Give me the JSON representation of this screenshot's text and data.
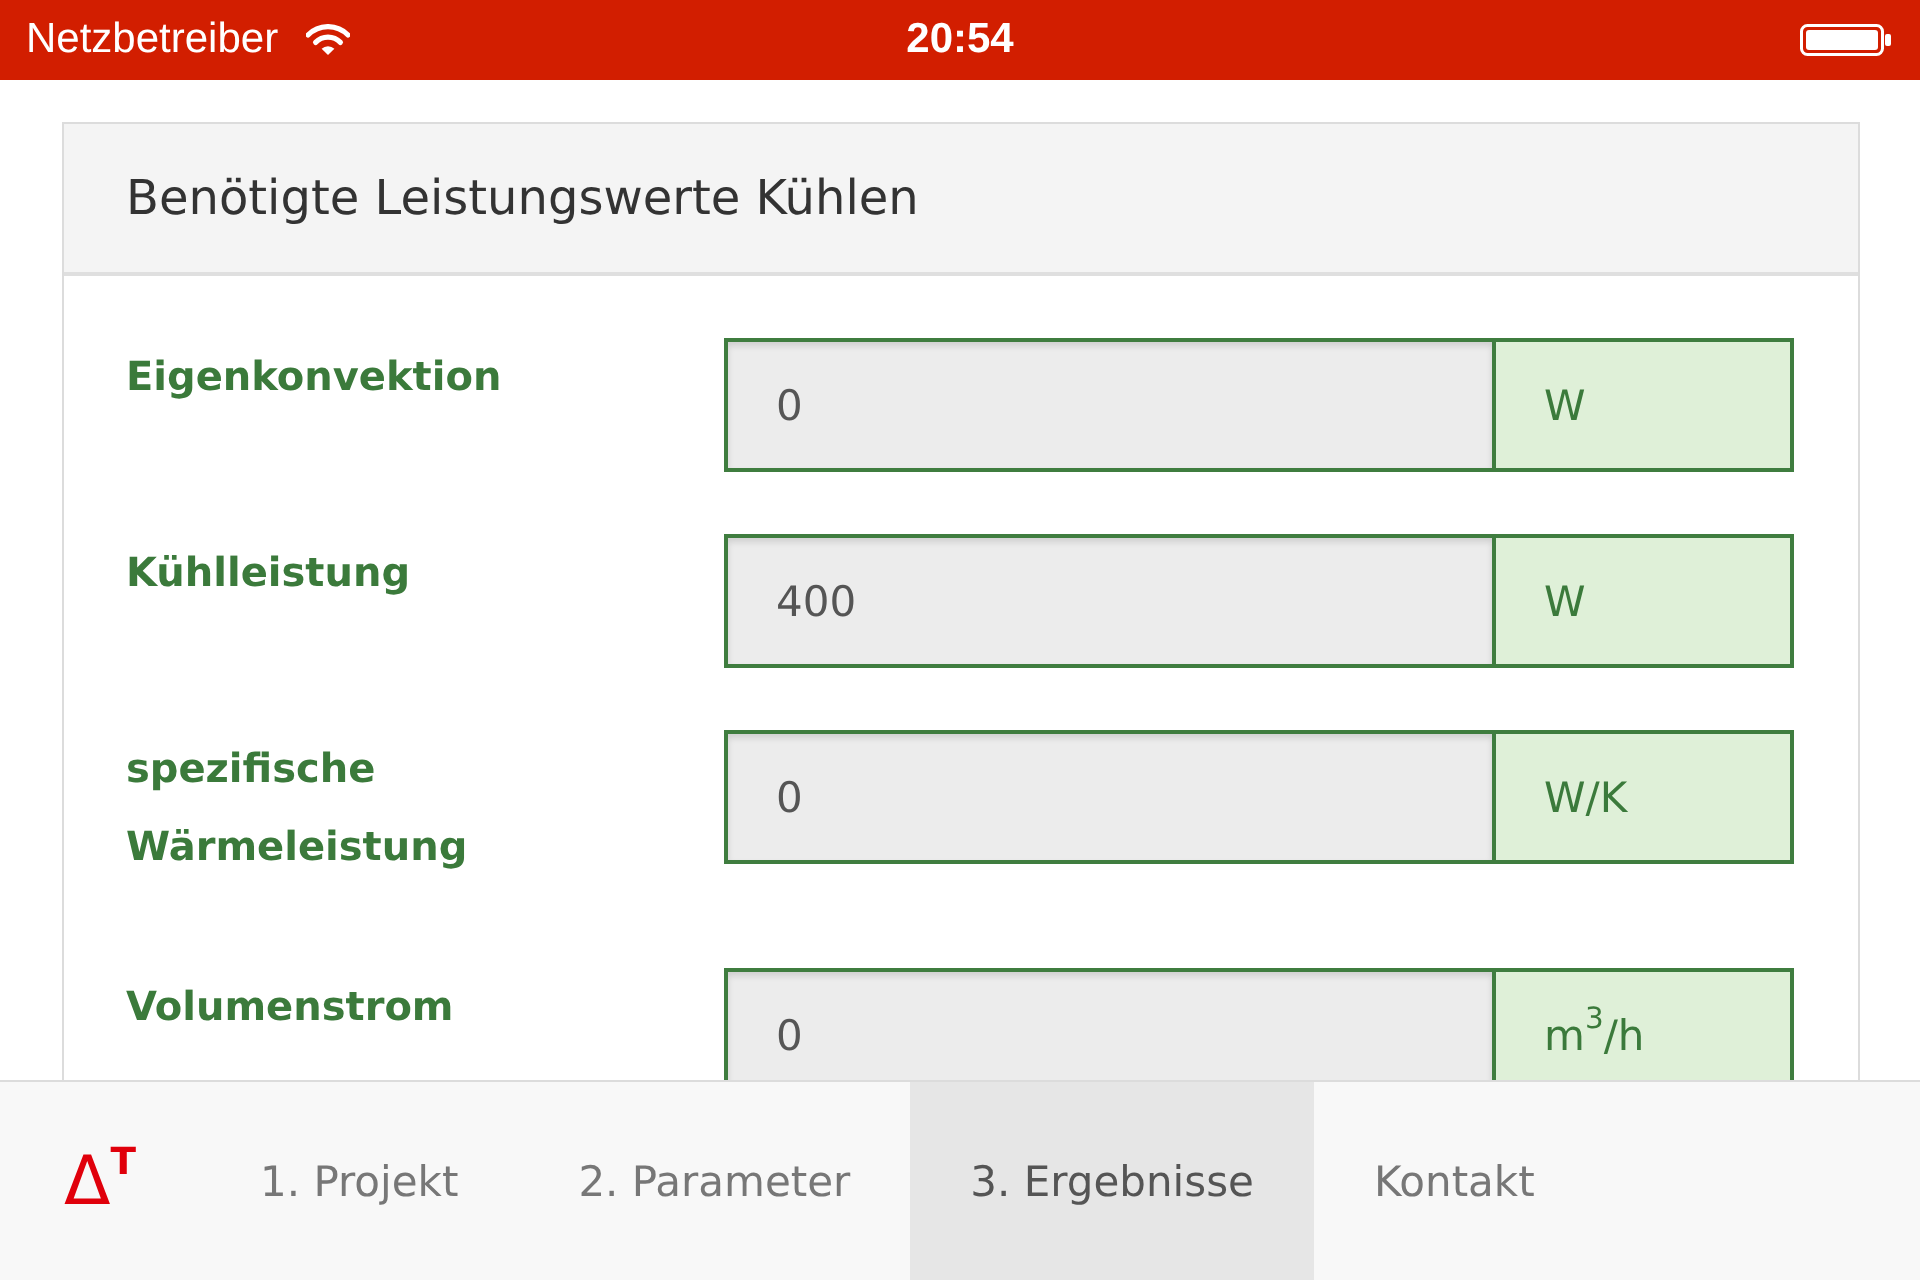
{
  "status_bar": {
    "carrier": "Netzbetreiber",
    "time": "20:54"
  },
  "card": {
    "title": "Benötigte Leistungswerte Kühlen",
    "rows": [
      {
        "label": "Eigenkonvektion",
        "value": "0",
        "unit": "W"
      },
      {
        "label": "Kühlleistung",
        "value": "400",
        "unit": "W"
      },
      {
        "label": "spezifische Wärmeleistung",
        "value": "0",
        "unit": "W/K"
      },
      {
        "label": "Volumenstrom",
        "value": "0",
        "unit": "m$^{3}$/h"
      }
    ]
  },
  "tab_bar": {
    "logo": "Δ$^{T}$",
    "tabs": [
      {
        "label": "1. Projekt",
        "selected": false
      },
      {
        "label": "2. Parameter",
        "selected": false
      },
      {
        "label": "3. Ergebnisse",
        "selected": true
      },
      {
        "label": "Kontakt",
        "selected": false
      }
    ]
  }
}
